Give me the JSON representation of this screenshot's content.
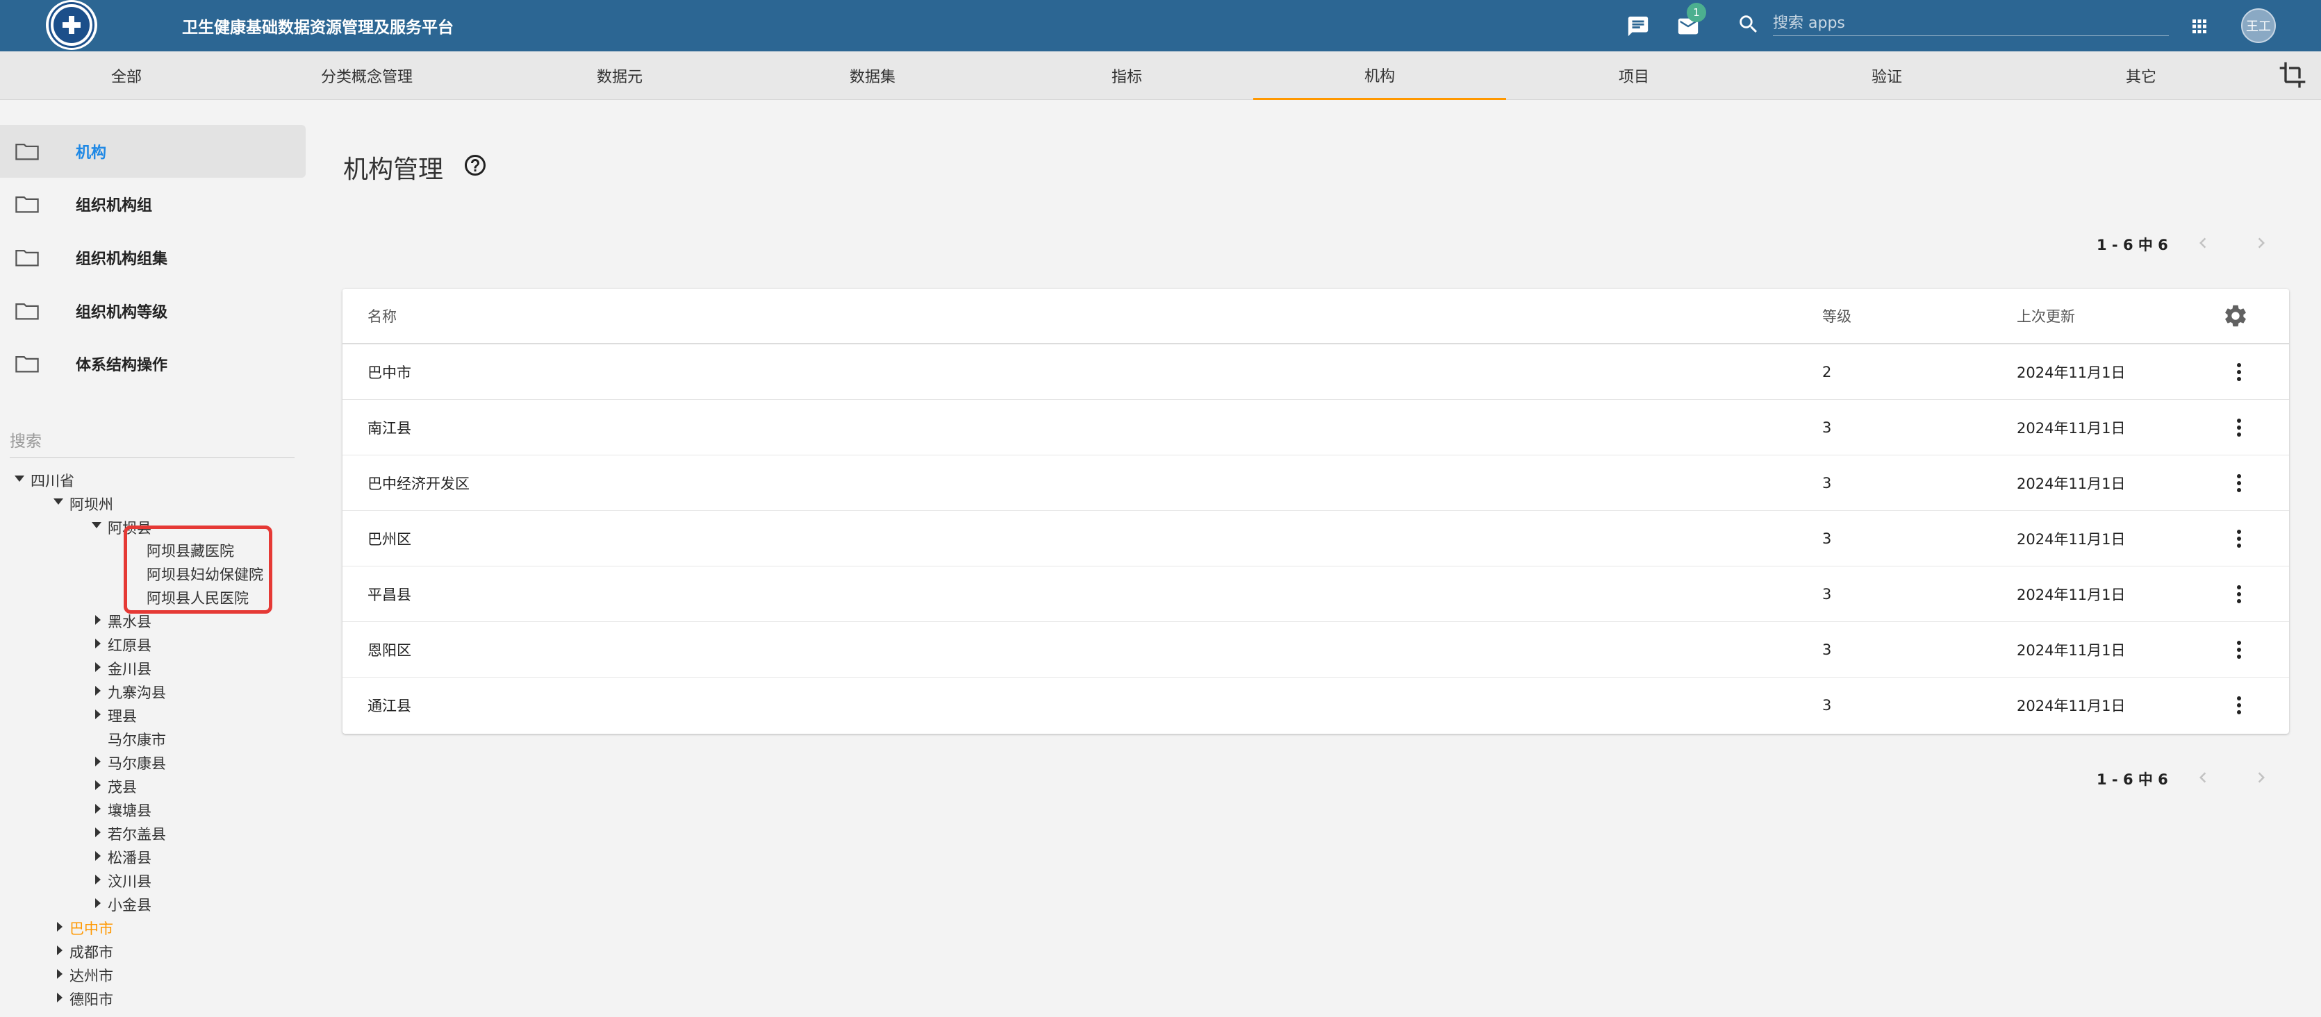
{
  "header": {
    "title": "卫生健康基础数据资源管理及服务平台",
    "badge_count": "1",
    "search_placeholder": "搜索 apps",
    "avatar_initials": "王工"
  },
  "topnav": {
    "items": [
      "全部",
      "分类概念管理",
      "数据元",
      "数据集",
      "指标",
      "机构",
      "项目",
      "验证",
      "其它"
    ],
    "active": "机构"
  },
  "sidebar": {
    "items": [
      "机构",
      "组织机构组",
      "组织机构组集",
      "组织机构等级",
      "体系结构操作"
    ],
    "active": "机构"
  },
  "tree": {
    "search_placeholder": "搜索",
    "nodes": {
      "root": "四川省",
      "aba_zhou": "阿坝州",
      "aba_xian": "阿坝县",
      "hosp1": "阿坝县藏医院",
      "hosp2": "阿坝县妇幼保健院",
      "hosp3": "阿坝县人民医院",
      "heishui": "黑水县",
      "hongyuan": "红原县",
      "jinchuan": "金川县",
      "jiuzhaigou": "九寨沟县",
      "lixian": "理县",
      "maerkang_shi": "马尔康市",
      "maerkang_xian": "马尔康县",
      "maoxian": "茂县",
      "rangtang": "壤塘县",
      "ruoergai": "若尔盖县",
      "songpan": "松潘县",
      "wenchuan": "汶川县",
      "xiaojin": "小金县",
      "bazhong": "巴中市",
      "chengdu": "成都市",
      "dazhou": "达州市",
      "deyang": "德阳市"
    }
  },
  "main": {
    "title": "机构管理",
    "pagination": "1 - 6 中 6",
    "columns": {
      "name": "名称",
      "level": "等级",
      "updated": "上次更新"
    },
    "rows": [
      {
        "name": "巴中市",
        "level": "2",
        "updated": "2024年11月1日"
      },
      {
        "name": "南江县",
        "level": "3",
        "updated": "2024年11月1日"
      },
      {
        "name": "巴中经济开发区",
        "level": "3",
        "updated": "2024年11月1日"
      },
      {
        "name": "巴州区",
        "level": "3",
        "updated": "2024年11月1日"
      },
      {
        "name": "平昌县",
        "level": "3",
        "updated": "2024年11月1日"
      },
      {
        "name": "恩阳区",
        "level": "3",
        "updated": "2024年11月1日"
      },
      {
        "name": "通江县",
        "level": "3",
        "updated": "2024年11月1日"
      }
    ]
  },
  "colors": {
    "header_bg": "#2c6693",
    "accent_active_tab": "#ff9800",
    "sidebar_active_text": "#1e88e5",
    "highlight_box": "#e53935",
    "badge": "#4caf8f"
  }
}
